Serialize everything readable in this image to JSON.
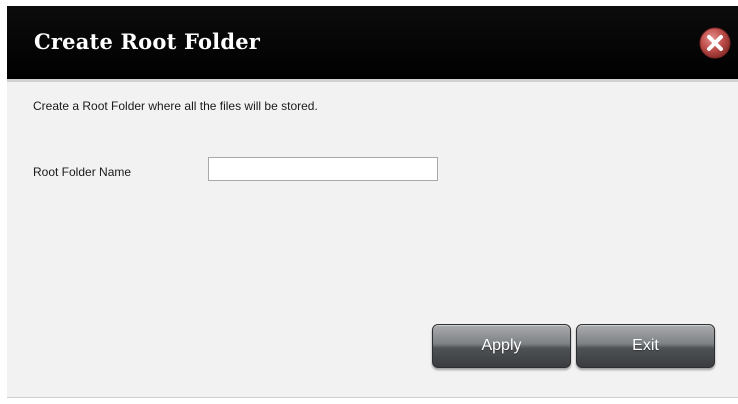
{
  "dialog": {
    "title": "Create Root Folder",
    "description": "Create a Root Folder where all the files will be stored.",
    "field_label": "Root Folder Name",
    "field_value": "",
    "field_placeholder": "",
    "apply_label": "Apply",
    "exit_label": "Exit",
    "close_icon": "close-x-circle-icon"
  },
  "colors": {
    "titlebar": "#000000",
    "close_icon": "#c0504d",
    "content_background": "#f2f2f2",
    "button": "#5a5d60"
  }
}
